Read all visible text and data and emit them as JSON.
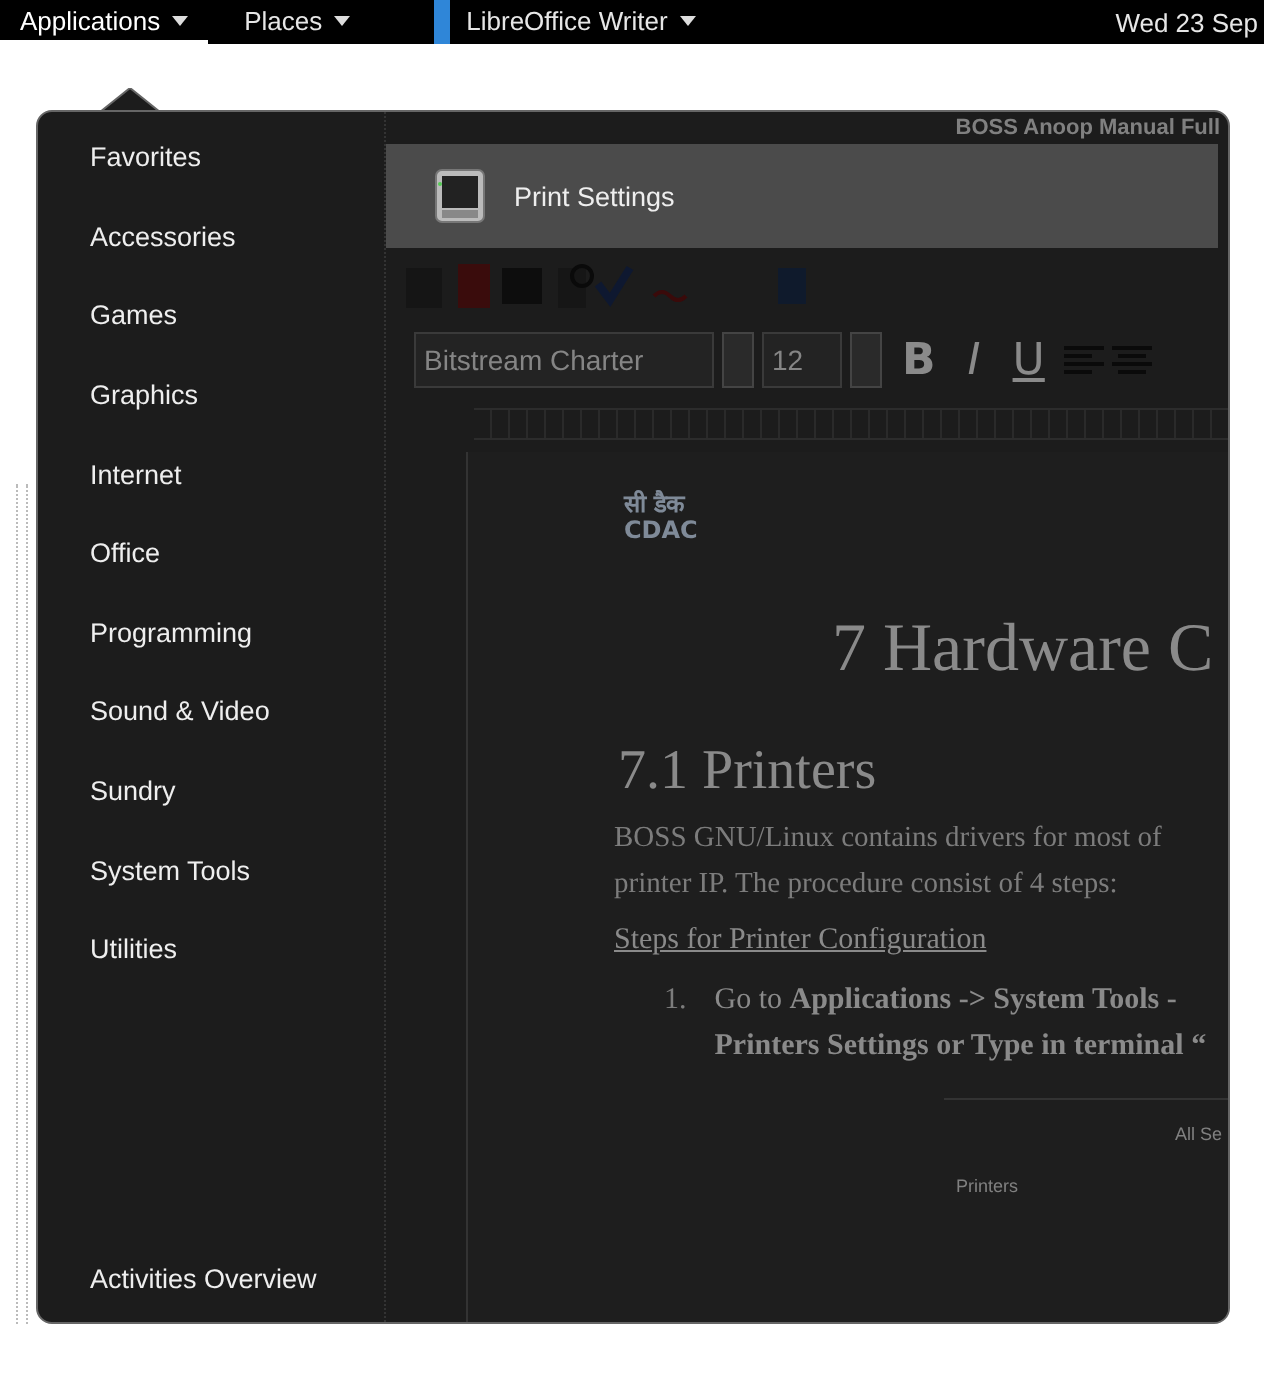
{
  "top_bar": {
    "menus": [
      {
        "label": "Applications",
        "selected": true
      },
      {
        "label": "Places",
        "selected": false
      }
    ],
    "app_menu": {
      "label": "LibreOffice Writer"
    },
    "clock": "Wed 23 Sep"
  },
  "document_title": "BOSS Anoop Manual Full",
  "applications_menu": {
    "categories": [
      "Favorites",
      "Accessories",
      "Games",
      "Graphics",
      "Internet",
      "Office",
      "Programming",
      "Sound & Video",
      "Sundry",
      "System Tools",
      "Utilities"
    ],
    "apps": [
      {
        "label": "Print Settings",
        "selected": true
      }
    ],
    "footer": "Activities Overview"
  },
  "formatting_bar": {
    "font_name": "Bitstream Charter",
    "font_size": "12",
    "buttons": [
      "B",
      "I",
      "U"
    ]
  },
  "page": {
    "logo_lines": [
      "सी डैक",
      "CDAC"
    ],
    "heading_1": "7  Hardware C",
    "heading_2": "7.1  Printers",
    "paragraph_lines": [
      "BOSS GNU/Linux contains drivers for most of",
      "printer IP. The procedure consist of 4 steps:"
    ],
    "subheading": "Steps for Printer Configuration",
    "list_item": {
      "number": "1.",
      "lines": [
        "Go to **Applications -> System Tools -**",
        "**Printers Settings or  Type in terminal “**"
      ]
    },
    "embedded_screenshot": {
      "label": "Printers",
      "header": "All Se"
    }
  }
}
